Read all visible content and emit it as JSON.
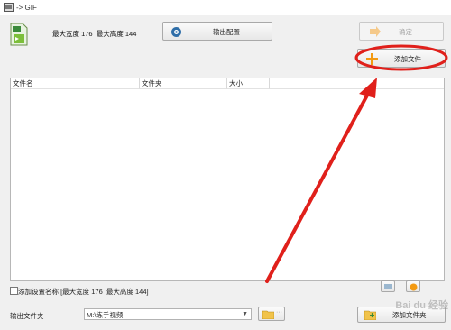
{
  "window": {
    "title": "-> GIF"
  },
  "format_info": {
    "dimensions_text": "最大宽度 176  最大高度 144"
  },
  "toolbar": {
    "output_settings_label": "输出配置",
    "ok_label": "确定",
    "add_file_label": "添加文件"
  },
  "file_table": {
    "columns": [
      {
        "label": "文件名"
      },
      {
        "label": "文件夹"
      },
      {
        "label": "大小"
      }
    ],
    "rows": []
  },
  "options": {
    "add_setting_name_label": "添加设置名称 [最大宽度 176  最大高度 144]",
    "add_setting_name_checked": false
  },
  "output": {
    "folder_label": "输出文件夹",
    "folder_value": "M:\\练手视频",
    "add_folder_label": "添加文件夹"
  },
  "watermark": {
    "text": "Bai du 经验"
  },
  "colors": {
    "annotation_red": "#e0201b",
    "add_icon_orange": "#f39a12",
    "output_icon_blue": "#2f6ea8"
  }
}
